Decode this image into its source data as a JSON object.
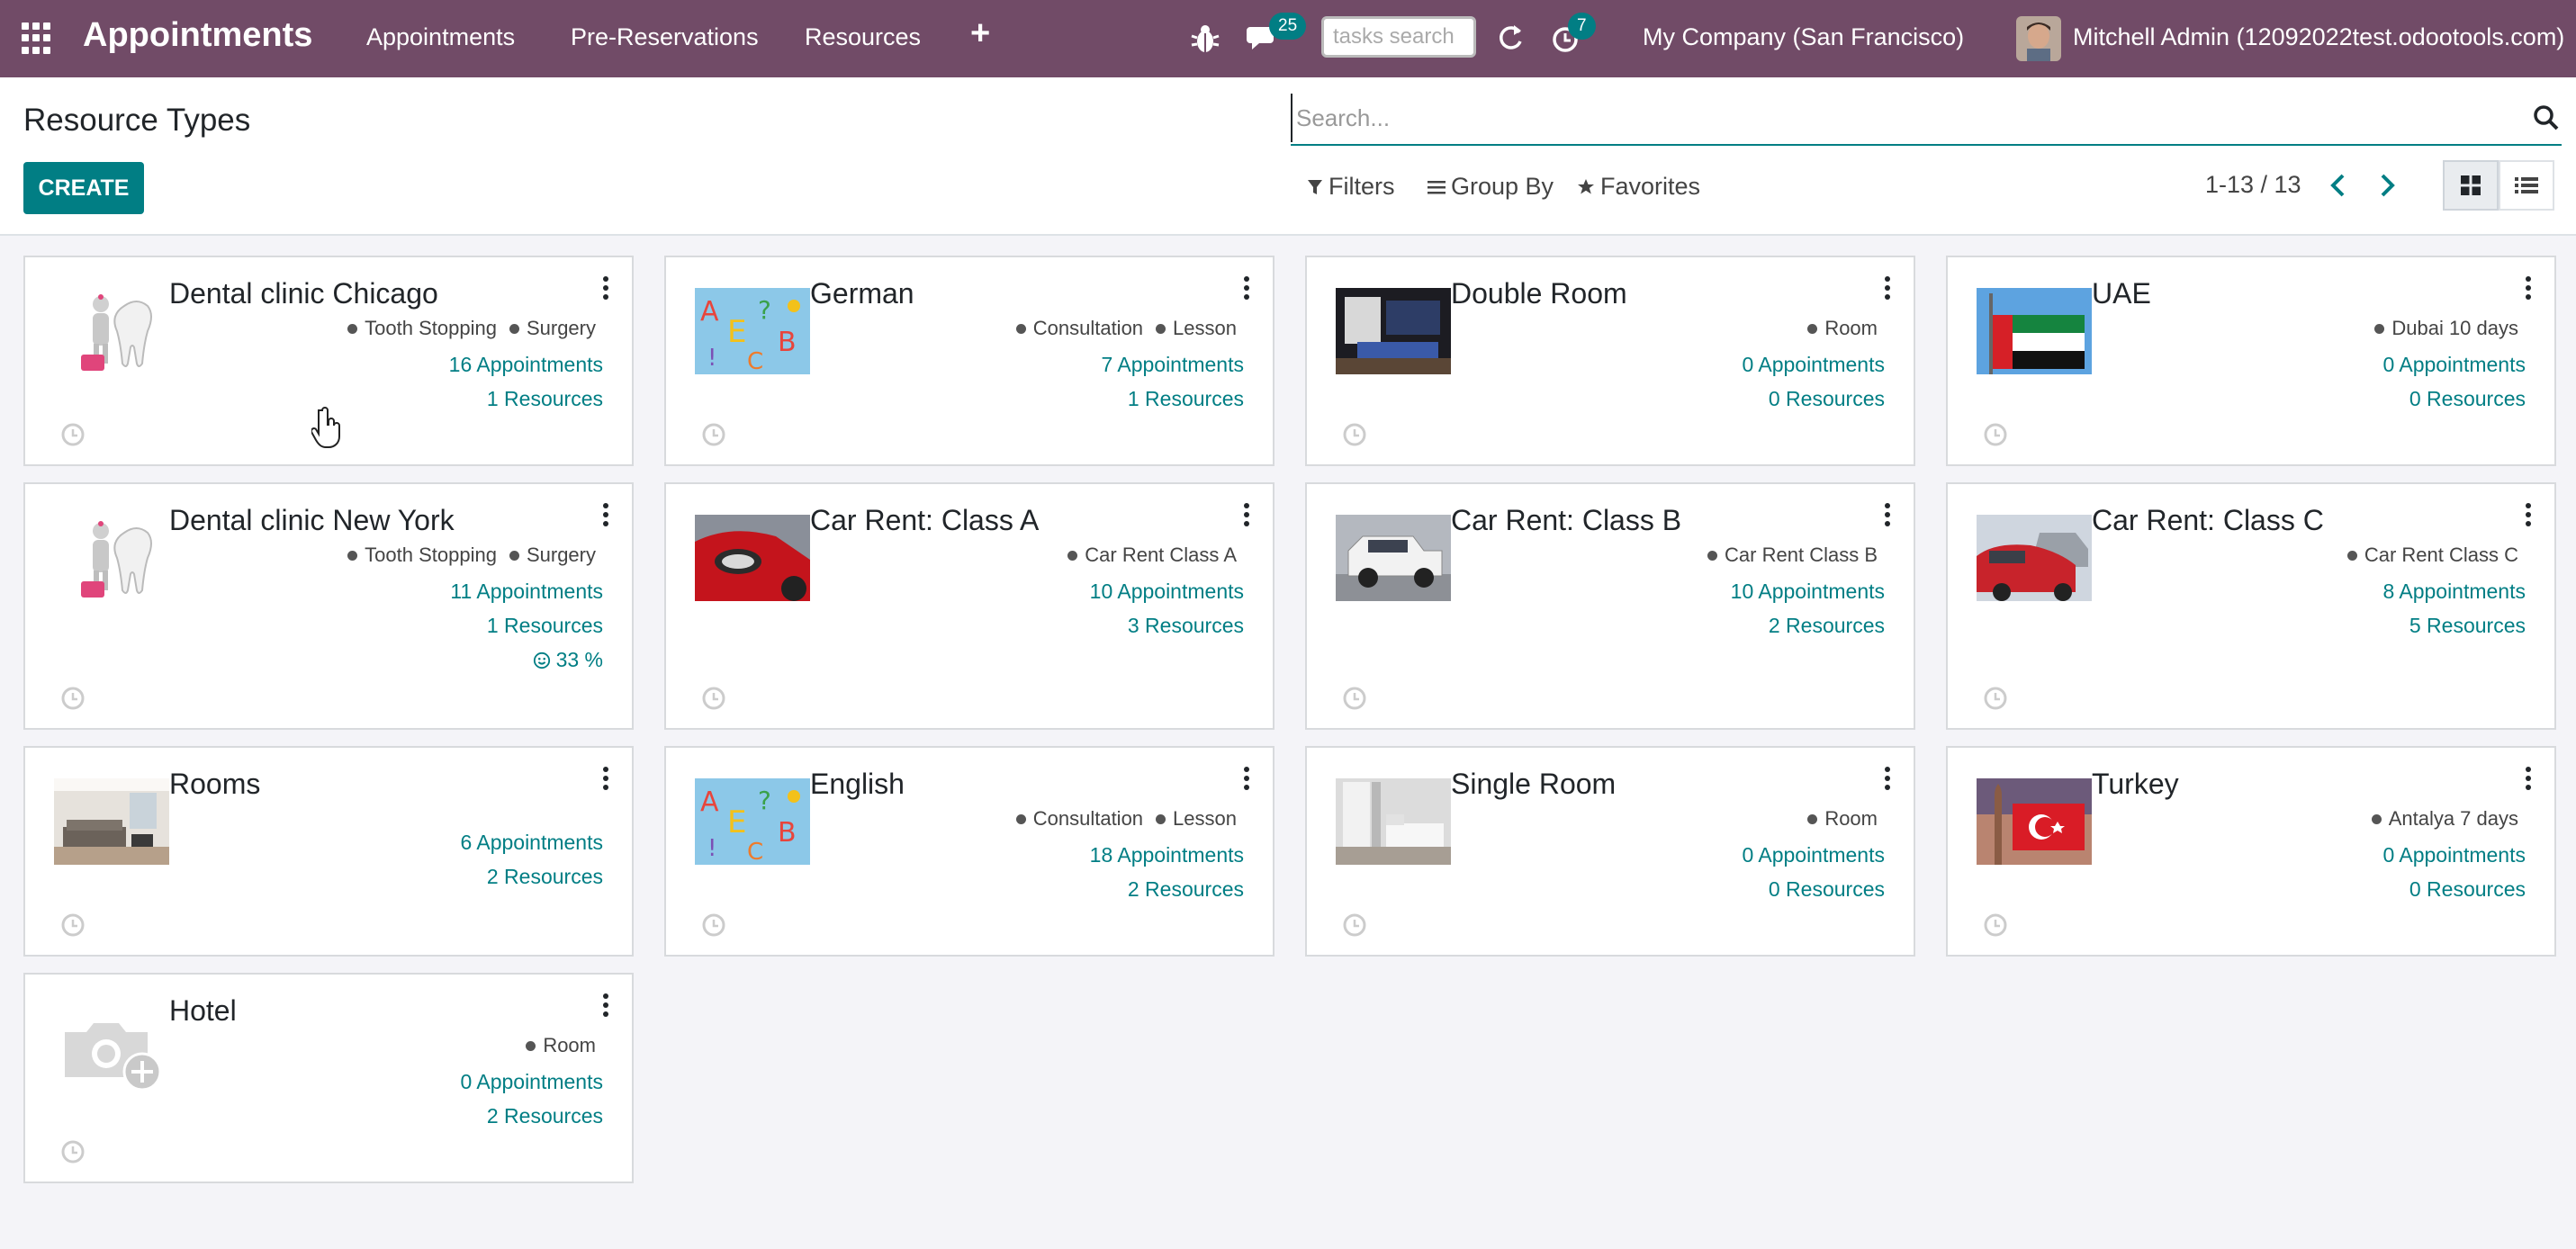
{
  "navbar": {
    "brand": "Appointments",
    "menu": [
      "Appointments",
      "Pre-Reservations",
      "Resources"
    ],
    "messages_count": "25",
    "activities_count": "7",
    "tasks_search_placeholder": "tasks search",
    "company": "My Company (San Francisco)",
    "user": "Mitchell Admin (12092022test.odootools.com)"
  },
  "control_panel": {
    "title": "Resource Types",
    "create_label": "CREATE",
    "search_placeholder": "Search...",
    "filters_label": "Filters",
    "group_by_label": "Group By",
    "favorites_label": "Favorites",
    "pager": "1-13 / 13"
  },
  "colors": {
    "navbar": "#714b67",
    "accent": "#017e84"
  },
  "cards": [
    {
      "title": "Dental clinic Chicago",
      "image": "tooth",
      "tags": [
        "Tooth Stopping",
        "Surgery"
      ],
      "appointments": "16 Appointments",
      "resources": "1 Resources"
    },
    {
      "title": "German",
      "image": "letters",
      "tags": [
        "Consultation",
        "Lesson"
      ],
      "appointments": "7 Appointments",
      "resources": "1 Resources"
    },
    {
      "title": "Double Room",
      "image": "room-dark",
      "tags": [
        "Room"
      ],
      "appointments": "0 Appointments",
      "resources": "0 Resources"
    },
    {
      "title": "UAE",
      "image": "flag-uae",
      "tags": [
        "Dubai 10 days"
      ],
      "appointments": "0 Appointments",
      "resources": "0 Resources"
    },
    {
      "title": "Dental clinic New York",
      "image": "tooth",
      "tags": [
        "Tooth Stopping",
        "Surgery"
      ],
      "appointments": "11 Appointments",
      "resources": "1 Resources",
      "rating": "33 %"
    },
    {
      "title": "Car Rent: Class A",
      "image": "car-red",
      "tags": [
        "Car Rent Class A"
      ],
      "appointments": "10 Appointments",
      "resources": "3 Resources"
    },
    {
      "title": "Car Rent: Class B",
      "image": "car-white",
      "tags": [
        "Car Rent Class B"
      ],
      "appointments": "10 Appointments",
      "resources": "2 Resources"
    },
    {
      "title": "Car Rent: Class C",
      "image": "car-lot",
      "tags": [
        "Car Rent Class C"
      ],
      "appointments": "8 Appointments",
      "resources": "5 Resources"
    },
    {
      "title": "Rooms",
      "image": "living-room",
      "tags": [],
      "appointments": "6 Appointments",
      "resources": "2 Resources"
    },
    {
      "title": "English",
      "image": "letters",
      "tags": [
        "Consultation",
        "Lesson"
      ],
      "appointments": "18 Appointments",
      "resources": "2 Resources"
    },
    {
      "title": "Single Room",
      "image": "room-light",
      "tags": [
        "Room"
      ],
      "appointments": "0 Appointments",
      "resources": "0 Resources"
    },
    {
      "title": "Turkey",
      "image": "flag-turkey",
      "tags": [
        "Antalya 7 days"
      ],
      "appointments": "0 Appointments",
      "resources": "0 Resources"
    },
    {
      "title": "Hotel",
      "image": "placeholder-camera",
      "tags": [
        "Room"
      ],
      "appointments": "0 Appointments",
      "resources": "2 Resources"
    }
  ]
}
